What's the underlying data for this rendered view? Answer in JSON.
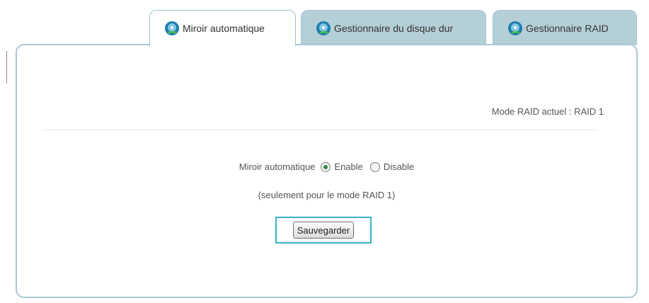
{
  "tabs": [
    {
      "label": "Miroir automatique",
      "icon": "disk-icon",
      "active": true
    },
    {
      "label": "Gestionnaire du disque dur",
      "icon": "disk-icon",
      "active": false
    },
    {
      "label": "Gestionnaire RAID",
      "icon": "disk-icon",
      "active": false
    }
  ],
  "panel": {
    "raid_mode": "Mode RAID actuel : RAID 1",
    "mirror": {
      "label": "Miroir automatique",
      "options": [
        {
          "label": "Enable",
          "checked": true
        },
        {
          "label": "Disable",
          "checked": false
        }
      ]
    },
    "note": "(seulement pour le mode RAID 1)",
    "save_label": "Sauvegarder"
  },
  "colors": {
    "tab_inactive": "#b5cfd6",
    "tab_border": "#a9c6d0",
    "panel_border": "#a9c8d2",
    "highlight": "#38b3c6",
    "radio_checked": "#2a8a42"
  }
}
